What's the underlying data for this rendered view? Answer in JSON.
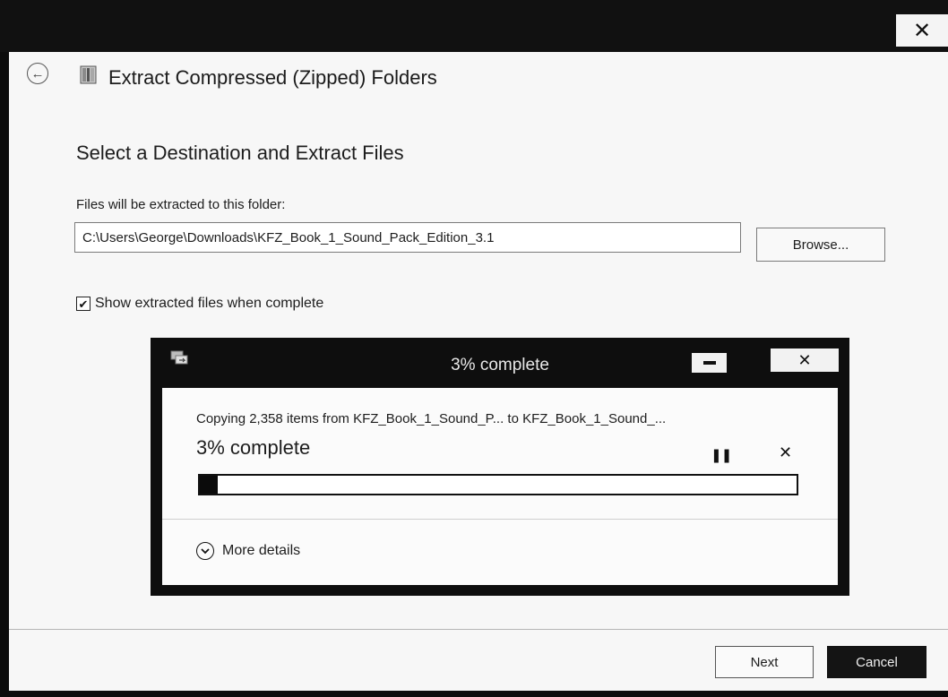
{
  "window": {
    "close_icon": "close-icon"
  },
  "wizard": {
    "back_icon": "back-arrow-icon",
    "folder_icon": "zip-folder-icon",
    "title": "Extract Compressed (Zipped) Folders",
    "heading": "Select a Destination and Extract Files",
    "destination_label": "Files will be extracted to this folder:",
    "destination_path": "C:\\Users\\George\\Downloads\\KFZ_Book_1_Sound_Pack_Edition_3.1",
    "browse_label": "Browse...",
    "show_files_checked": true,
    "show_files_label": "Show extracted files when complete",
    "next_label": "Next",
    "cancel_label": "Cancel"
  },
  "copy_dialog": {
    "icon": "copy-files-icon",
    "title": "3% complete",
    "message": "Copying 2,358 items from KFZ_Book_1_Sound_P... to KFZ_Book_1_Sound_...",
    "percent_text": "3% complete",
    "progress_fraction": 0.03,
    "pause_icon": "pause-icon",
    "cancel_icon": "close-icon",
    "more_details_label": "More details",
    "colors": {
      "frame": "#0e0e0e",
      "progress_fill": "#0b0b0b"
    }
  }
}
